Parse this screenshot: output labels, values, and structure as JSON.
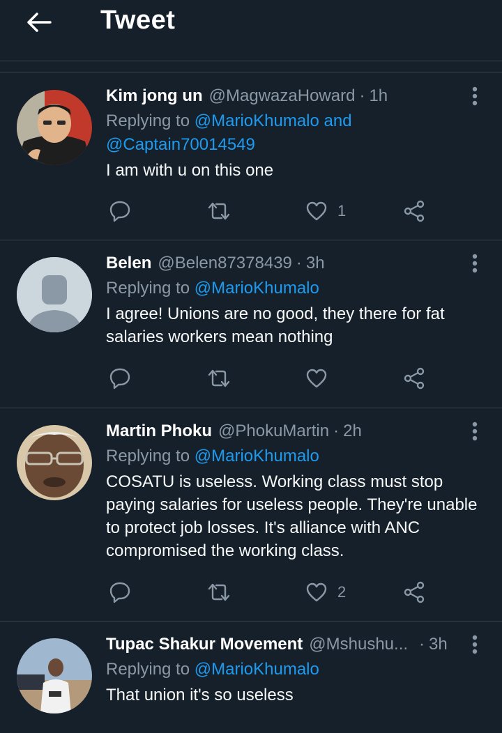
{
  "header": {
    "title": "Tweet",
    "back_icon": "arrow-left-icon"
  },
  "colors": {
    "background": "#15202b",
    "accent": "#1d9bf0",
    "muted": "#8b98a5",
    "divider": "#38444d"
  },
  "tweets": [
    {
      "name": "Kim jong un",
      "handle": "@MagwazaHoward",
      "time": "1h",
      "replying_prefix": "Replying to ",
      "replying_to": "@MarioKhumalo and",
      "replying_to_2": "@Captain70014549",
      "text": "I am with u on this one",
      "likes": "1"
    },
    {
      "name": "Belen",
      "handle": "@Belen87378439",
      "time": "3h",
      "replying_prefix": "Replying to ",
      "replying_to": "@MarioKhumalo",
      "text": "I agree!  Unions are no good,  they there for fat salaries workers mean nothing",
      "likes": ""
    },
    {
      "name": "Martin Phoku",
      "handle": "@PhokuMartin",
      "time": "2h",
      "replying_prefix": "Replying to ",
      "replying_to": "@MarioKhumalo",
      "text": "COSATU is useless. Working class must stop paying salaries for useless people. They're unable to protect job losses. It's alliance with ANC compromised the working class.",
      "likes": "2"
    },
    {
      "name": "Tupac Shakur Movement",
      "handle": "@Mshushu...",
      "time": "3h",
      "replying_prefix": "Replying to ",
      "replying_to": "@MarioKhumalo",
      "text": "That union it's so useless",
      "likes": ""
    }
  ]
}
